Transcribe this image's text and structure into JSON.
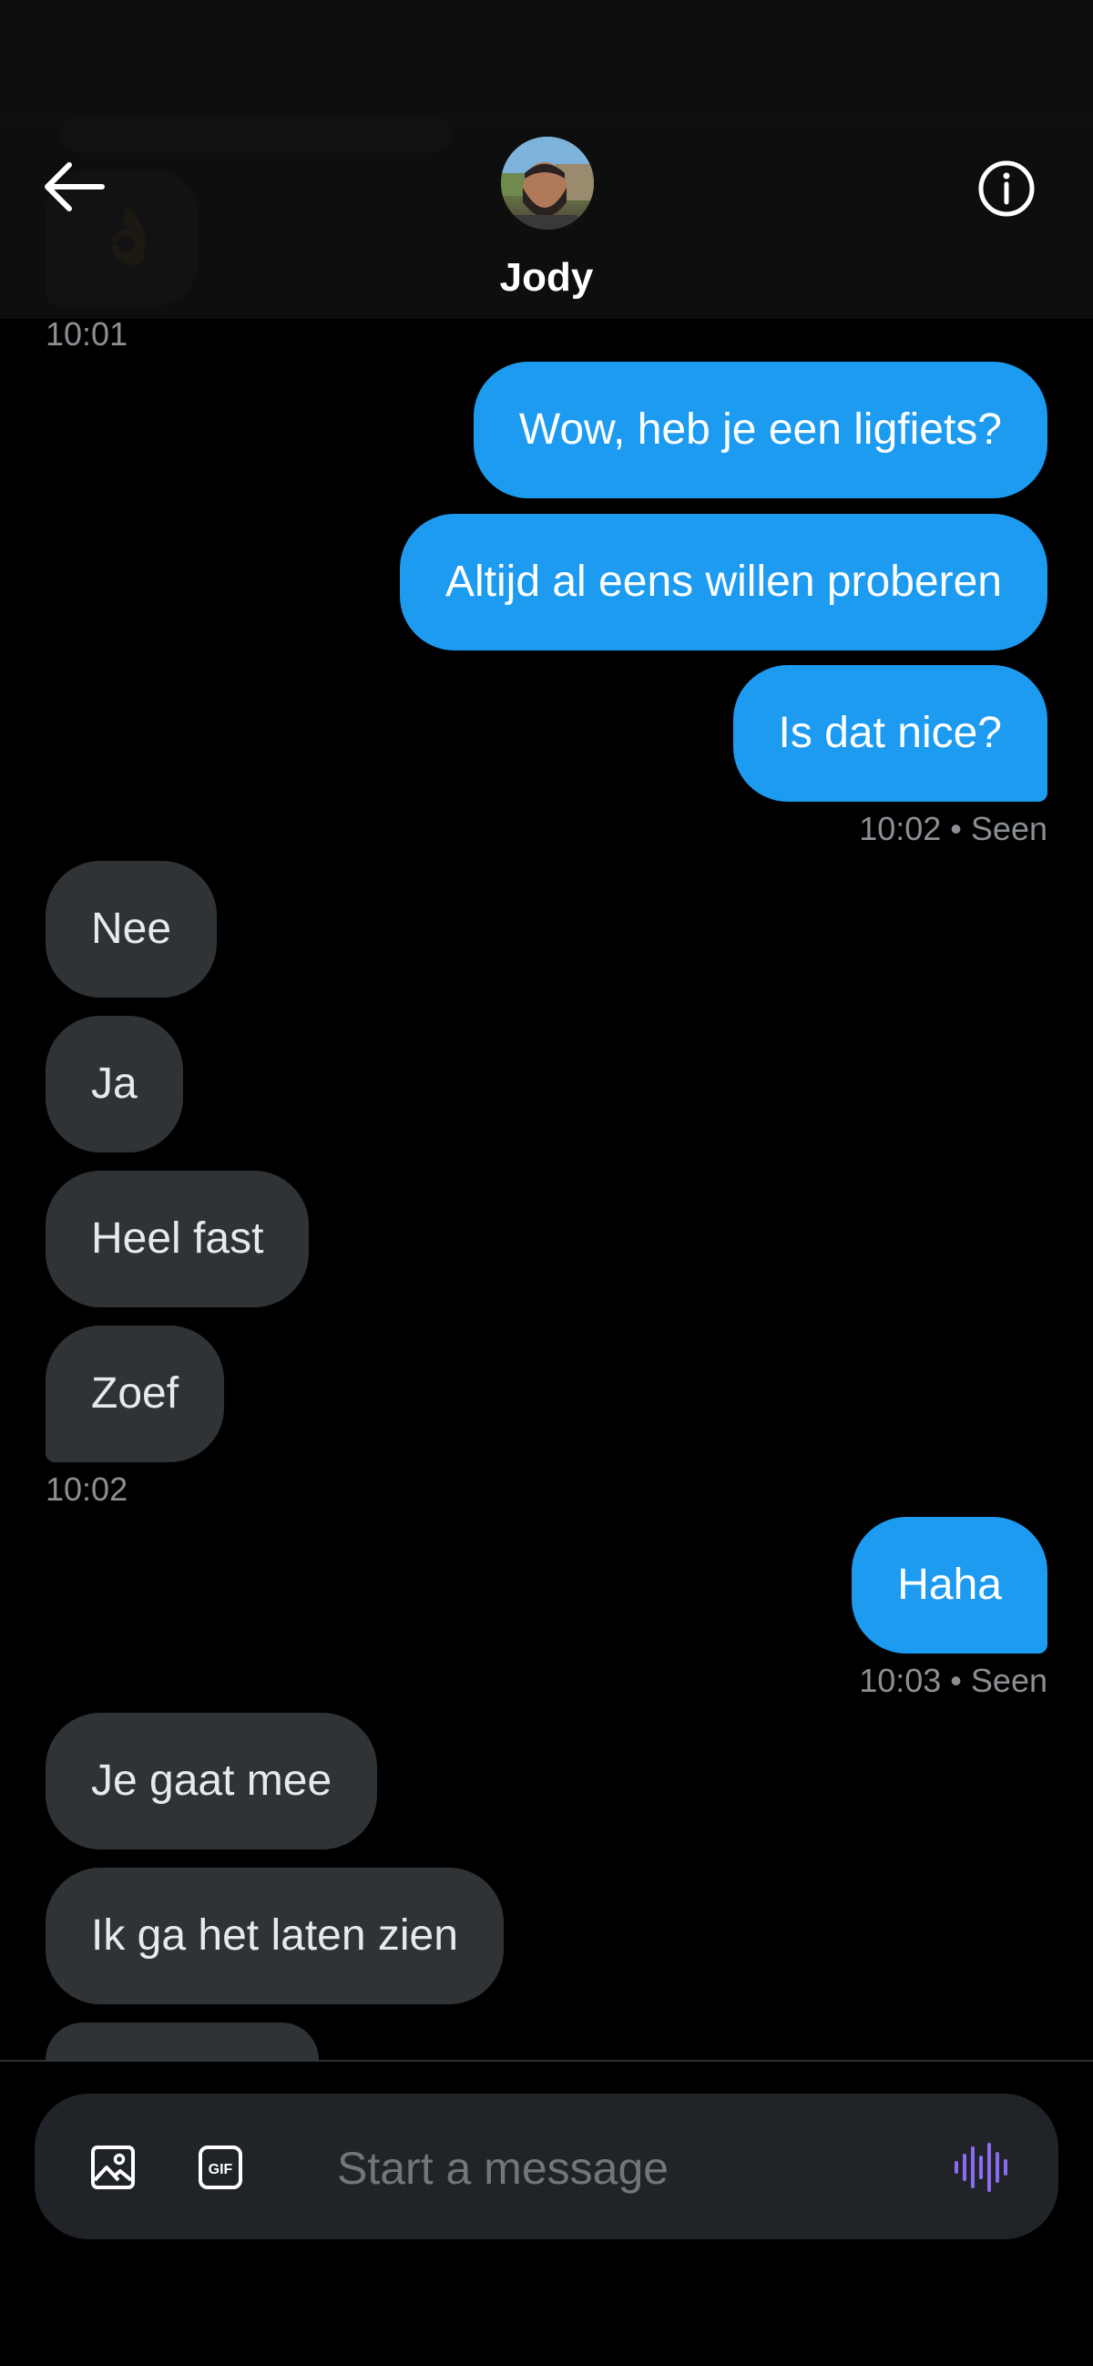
{
  "header": {
    "contact_name": "Jody"
  },
  "messages": [
    {
      "side": "them",
      "text": "👌",
      "timestamp": "10:01"
    },
    {
      "side": "me",
      "text": "Wow, heb je een ligfiets?"
    },
    {
      "side": "me",
      "text": "Altijd al eens willen proberen"
    },
    {
      "side": "me",
      "text": "Is dat nice?",
      "timestamp": "10:02 • Seen"
    },
    {
      "side": "them",
      "text": "Nee"
    },
    {
      "side": "them",
      "text": "Ja"
    },
    {
      "side": "them",
      "text": "Heel fast"
    },
    {
      "side": "them",
      "text": "Zoef",
      "timestamp": "10:02"
    },
    {
      "side": "me",
      "text": "Haha",
      "timestamp": "10:03 • Seen"
    },
    {
      "side": "them",
      "text": "Je gaat mee"
    },
    {
      "side": "them",
      "text": "Ik ga het laten zien"
    }
  ],
  "composer": {
    "placeholder": "Start a message",
    "gif_label": "GIF"
  },
  "icons": {
    "back": "arrow-left-icon",
    "info": "info-icon",
    "image": "image-icon",
    "gif": "gif-icon",
    "voice": "voice-waveform-icon"
  },
  "colors": {
    "background": "#000000",
    "sent_bubble": "#1d9bf0",
    "received_bubble": "#2f3336",
    "composer": "#202327",
    "voice_accent": "#8b6bf0"
  }
}
